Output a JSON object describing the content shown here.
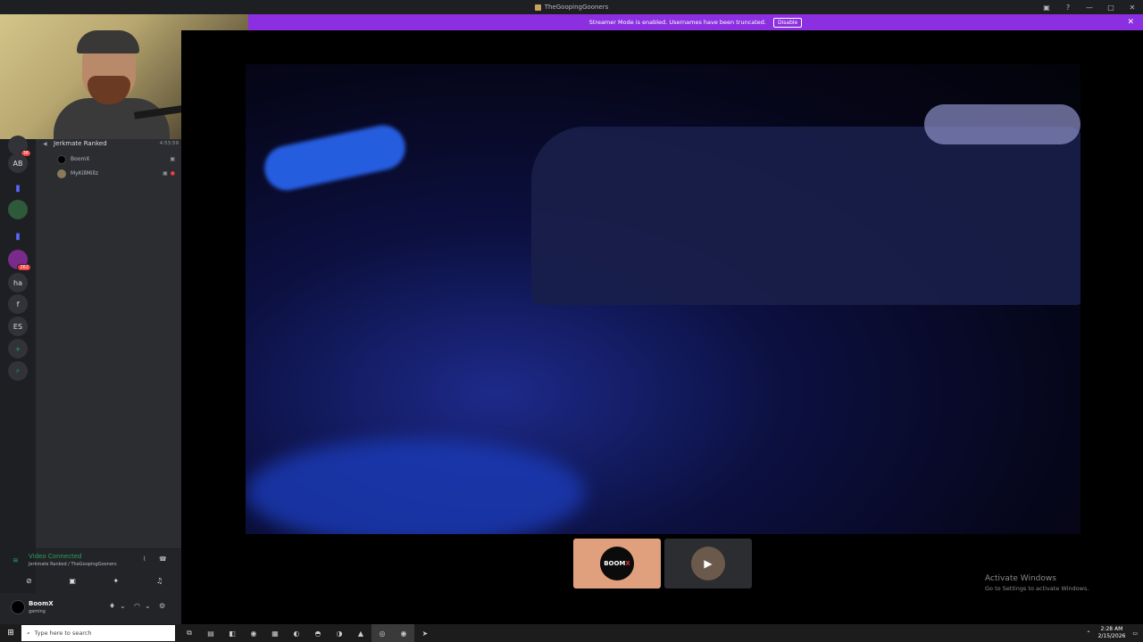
{
  "window": {
    "title": "TheGoopingGooners",
    "controls": [
      "▣",
      "?",
      "—",
      "□",
      "✕"
    ]
  },
  "banner": {
    "message": "Streamer Mode is enabled. Usernames have been truncated.",
    "disable_label": "Disable",
    "close_glyph": "✕"
  },
  "rail": {
    "servers": [
      {
        "label": "",
        "badge": "38"
      },
      {
        "label": "AB"
      },
      {
        "label": "▮",
        "folder": true
      },
      {
        "label": ""
      },
      {
        "label": "▮",
        "folder": true
      },
      {
        "label": "",
        "badge": "262"
      },
      {
        "label": "ha"
      },
      {
        "label": "f"
      },
      {
        "label": "ES"
      },
      {
        "label": "+"
      },
      {
        "label": "⌕"
      }
    ]
  },
  "voice_channel": {
    "name": "Jerkmate Ranked",
    "elapsed": "4:53:59",
    "members": [
      {
        "name": "BoomX"
      },
      {
        "name": "MyKillMillz"
      }
    ]
  },
  "voice_panel": {
    "status": "Video Connected",
    "location": "Jerkmate Ranked / TheGoopingGooners"
  },
  "user_panel": {
    "username": "BoomX",
    "status": "gaming"
  },
  "stage": {
    "tiles": [
      {
        "label": "BOOM",
        "label_x": "X",
        "active": true
      },
      {
        "label": "▶",
        "active": false
      }
    ]
  },
  "watermark": {
    "line1": "Activate Windows",
    "line2": "Go to Settings to activate Windows."
  },
  "taskbar": {
    "search_placeholder": "Type here to search",
    "time": "2:28 AM",
    "date": "2/15/2026",
    "app_icons": [
      "⧉",
      "▤",
      "◧",
      "◉",
      "▦",
      "◐",
      "◓",
      "◑",
      "▲",
      "◎",
      "◉",
      "➤"
    ]
  },
  "colors": {
    "banner": "#8b2fe0",
    "connected": "#23a55a",
    "active_tile": "#e0a07e",
    "badge": "#f23f43"
  }
}
